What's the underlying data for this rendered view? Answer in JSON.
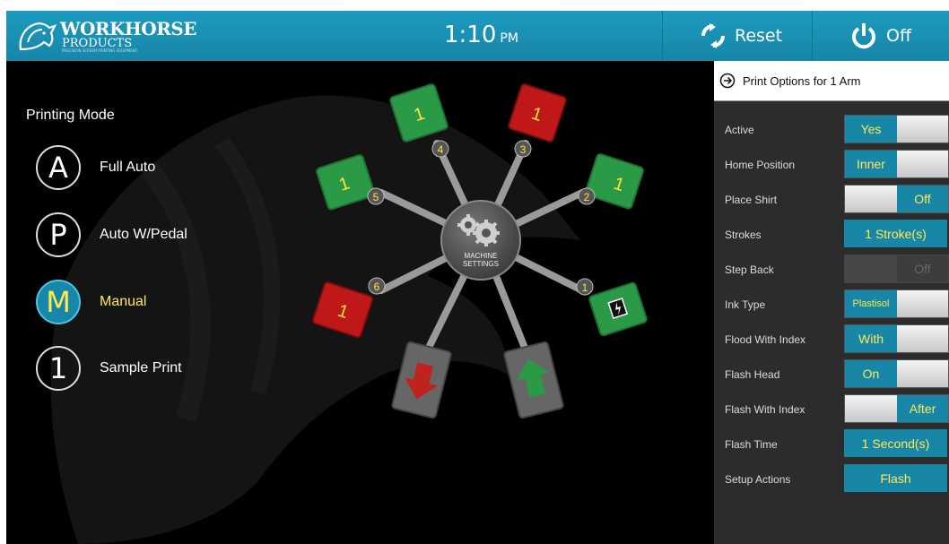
{
  "app": {
    "brand_line1": "WORKHORSE",
    "brand_line2": "PRODUCTS",
    "brand_tagline": "PRECISION SCREEN PRINTING EQUIPMENT"
  },
  "header": {
    "time": "1:10",
    "ampm": "PM",
    "reset_label": "Reset",
    "off_label": "Off"
  },
  "printing_mode": {
    "title": "Printing Mode",
    "modes": [
      {
        "letter": "A",
        "label": "Full Auto",
        "selected": false
      },
      {
        "letter": "P",
        "label": "Auto W/Pedal",
        "selected": false
      },
      {
        "letter": "M",
        "label": "Manual",
        "selected": true
      },
      {
        "letter": "1",
        "label": "Sample Print",
        "selected": false
      }
    ]
  },
  "machine": {
    "hub_label_line1": "MACHINE",
    "hub_label_line2": "SETTINGS",
    "arms": [
      {
        "number": "1",
        "value": "",
        "state": "flash",
        "color": "#2a9a47"
      },
      {
        "number": "2",
        "value": "1",
        "state": "active",
        "color": "#2a9a47"
      },
      {
        "number": "3",
        "value": "1",
        "state": "inactive",
        "color": "#c01818"
      },
      {
        "number": "4",
        "value": "1",
        "state": "active",
        "color": "#2a9a47"
      },
      {
        "number": "5",
        "value": "1",
        "state": "active",
        "color": "#2a9a47"
      },
      {
        "number": "6",
        "value": "1",
        "state": "inactive",
        "color": "#c01818"
      }
    ],
    "unload_arrow": "down-arrow-icon",
    "load_arrow": "up-arrow-icon"
  },
  "print_options": {
    "title": "Print Options for 1 Arm",
    "rows": [
      {
        "label": "Active",
        "value": "Yes",
        "kind": "toggle-left"
      },
      {
        "label": "Home Position",
        "value": "Inner",
        "kind": "toggle-left"
      },
      {
        "label": "Place Shirt",
        "value": "Off",
        "kind": "toggle-right"
      },
      {
        "label": "Strokes",
        "value": "1 Stroke(s)",
        "kind": "button"
      },
      {
        "label": "Step Back",
        "value": "Off",
        "kind": "disabled"
      },
      {
        "label": "Ink Type",
        "value": "Plastisol",
        "kind": "toggle-left"
      },
      {
        "label": "Flood With Index",
        "value": "With",
        "kind": "toggle-left"
      },
      {
        "label": "Flash Head",
        "value": "On",
        "kind": "toggle-left"
      },
      {
        "label": "Flash With Index",
        "value": "After",
        "kind": "toggle-right"
      },
      {
        "label": "Flash Time",
        "value": "1 Second(s)",
        "kind": "button"
      },
      {
        "label": "Setup Actions",
        "value": "Flash",
        "kind": "button"
      }
    ]
  },
  "colors": {
    "accent": "#1786a7",
    "highlight": "#ffea52",
    "active_arm": "#2a9a47",
    "inactive_arm": "#c01818"
  }
}
